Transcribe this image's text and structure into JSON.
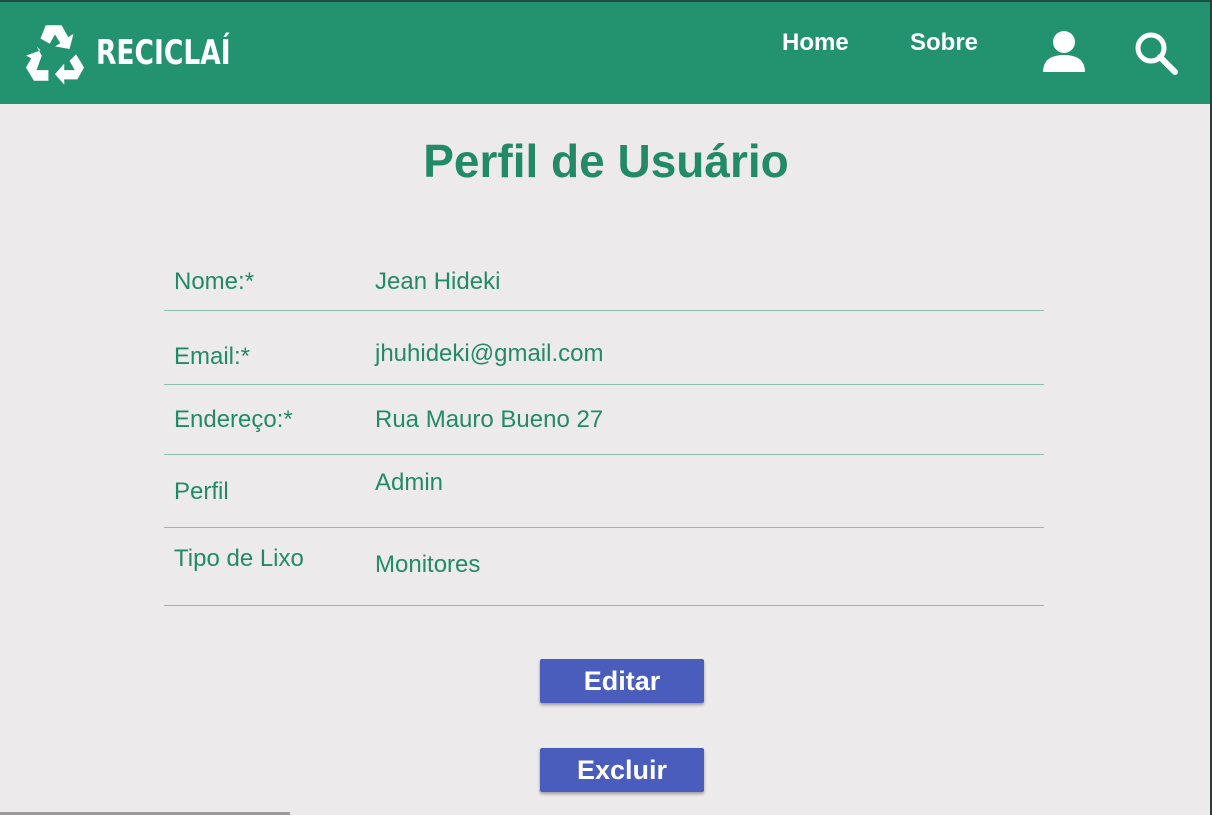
{
  "header": {
    "brand": "RECICLAÍ",
    "nav": {
      "home": "Home",
      "sobre": "Sobre"
    },
    "icons": {
      "logo": "recycle-icon",
      "user": "user-icon",
      "search": "search-icon"
    },
    "color": "#23926e"
  },
  "page": {
    "title": "Perfil de Usuário",
    "text_color": "#238a68"
  },
  "profile": {
    "fields": [
      {
        "label": "Nome:*",
        "value": "Jean Hideki"
      },
      {
        "label": "Email:*",
        "value": "jhuhideki@gmail.com"
      },
      {
        "label": "Endereço:*",
        "value": "Rua Mauro Bueno 27"
      },
      {
        "label": "Perfil",
        "value": "Admin"
      },
      {
        "label": "Tipo de Lixo",
        "value": "Monitores"
      }
    ]
  },
  "actions": {
    "edit": "Editar",
    "delete": "Excluir",
    "button_color": "#4a5dbd"
  }
}
